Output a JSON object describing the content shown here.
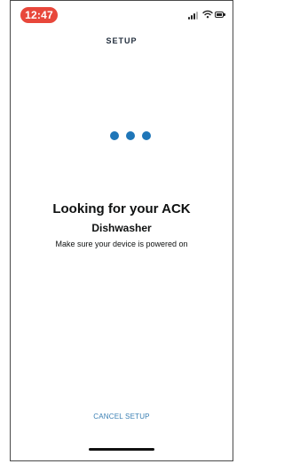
{
  "status_bar": {
    "time": "12:47",
    "signal_icon": "cellular-signal-icon",
    "wifi_icon": "wifi-icon",
    "battery_icon": "battery-icon"
  },
  "header": {
    "title": "SETUP"
  },
  "loading": {
    "indicator": "loading-dots",
    "dot_count": 3,
    "color": "#1f76b8"
  },
  "main": {
    "heading": "Looking for your ACK",
    "subheading": "Dishwasher",
    "hint": "Make sure your device is powered on"
  },
  "footer": {
    "cancel_label": "CANCEL SETUP"
  },
  "colors": {
    "time_pill": "#e8473b",
    "accent": "#1f76b8",
    "link": "#3a7fb3"
  }
}
